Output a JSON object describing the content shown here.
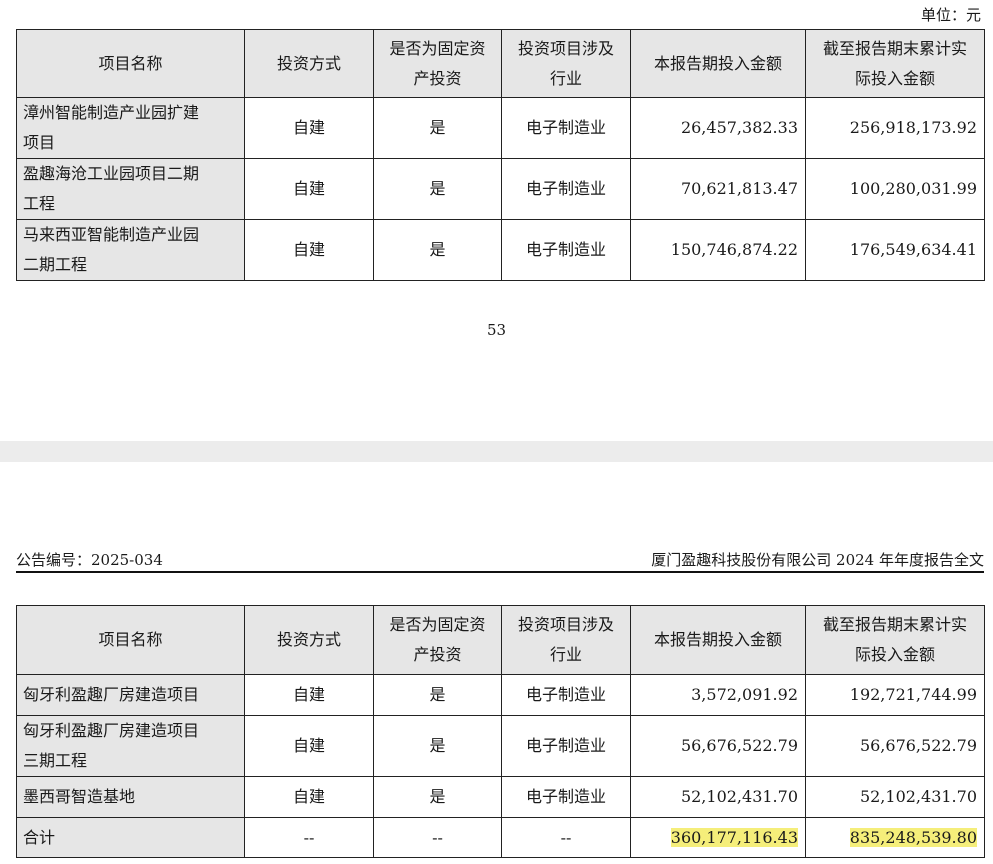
{
  "unit_label": "单位：元",
  "page_number": "53",
  "header": {
    "code": "公告编号：2025-034",
    "company_title": "厦门盈趣科技股份有限公司 2024 年年度报告全文"
  },
  "columns": [
    "项目名称",
    "投资方式",
    "是否为固定资产投资",
    "投资项目涉及行业",
    "本报告期投入金额",
    "截至报告期末累计实际投入金额"
  ],
  "columns_split": {
    "col3_l1": "是否为固定资",
    "col3_l2": "产投资",
    "col4_l1": "投资项目涉及",
    "col4_l2": "行业",
    "col6_l1": "截至报告期末累计实",
    "col6_l2": "际投入金额"
  },
  "table_top": {
    "rows": [
      {
        "name_l1": "漳州智能制造产业园扩建",
        "name_l2": "项目",
        "method": "自建",
        "fixed": "是",
        "industry": "电子制造业",
        "current": "26,457,382.33",
        "cumulative": "256,918,173.92"
      },
      {
        "name_l1": "盈趣海沧工业园项目二期",
        "name_l2": "工程",
        "method": "自建",
        "fixed": "是",
        "industry": "电子制造业",
        "current": "70,621,813.47",
        "cumulative": "100,280,031.99"
      },
      {
        "name_l1": "马来西亚智能制造产业园",
        "name_l2": "二期工程",
        "method": "自建",
        "fixed": "是",
        "industry": "电子制造业",
        "current": "150,746,874.22",
        "cumulative": "176,549,634.41"
      }
    ]
  },
  "table_bottom": {
    "rows": [
      {
        "name_l1": "匈牙利盈趣厂房建造项目",
        "name_l2": "",
        "method": "自建",
        "fixed": "是",
        "industry": "电子制造业",
        "current": "3,572,091.92",
        "cumulative": "192,721,744.99"
      },
      {
        "name_l1": "匈牙利盈趣厂房建造项目",
        "name_l2": "三期工程",
        "method": "自建",
        "fixed": "是",
        "industry": "电子制造业",
        "current": "56,676,522.79",
        "cumulative": "56,676,522.79"
      },
      {
        "name_l1": "墨西哥智造基地",
        "name_l2": "",
        "method": "自建",
        "fixed": "是",
        "industry": "电子制造业",
        "current": "52,102,431.70",
        "cumulative": "52,102,431.70"
      }
    ],
    "total": {
      "name": "合计",
      "method": "--",
      "fixed": "--",
      "industry": "--",
      "current": "360,177,116.43",
      "cumulative": "835,248,539.80"
    }
  },
  "colors": {
    "header_bg": "#e6e6e6",
    "highlight": "#f5ee7a",
    "border": "#222222"
  }
}
